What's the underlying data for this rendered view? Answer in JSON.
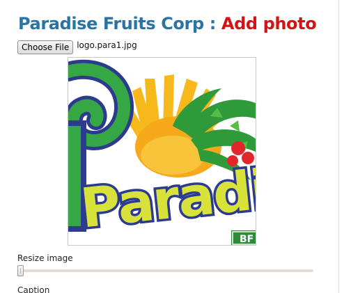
{
  "header": {
    "company": "Paradise Fruits Corp",
    "separator": ":",
    "action": "Add photo"
  },
  "file_input": {
    "button_label": "Choose File",
    "file_name": "logo.para1.jpg"
  },
  "preview": {
    "logo_text": "Paradis",
    "logo_badge": "BF"
  },
  "resize": {
    "label": "Resize image",
    "value": 0
  },
  "caption": {
    "label": "Caption"
  }
}
